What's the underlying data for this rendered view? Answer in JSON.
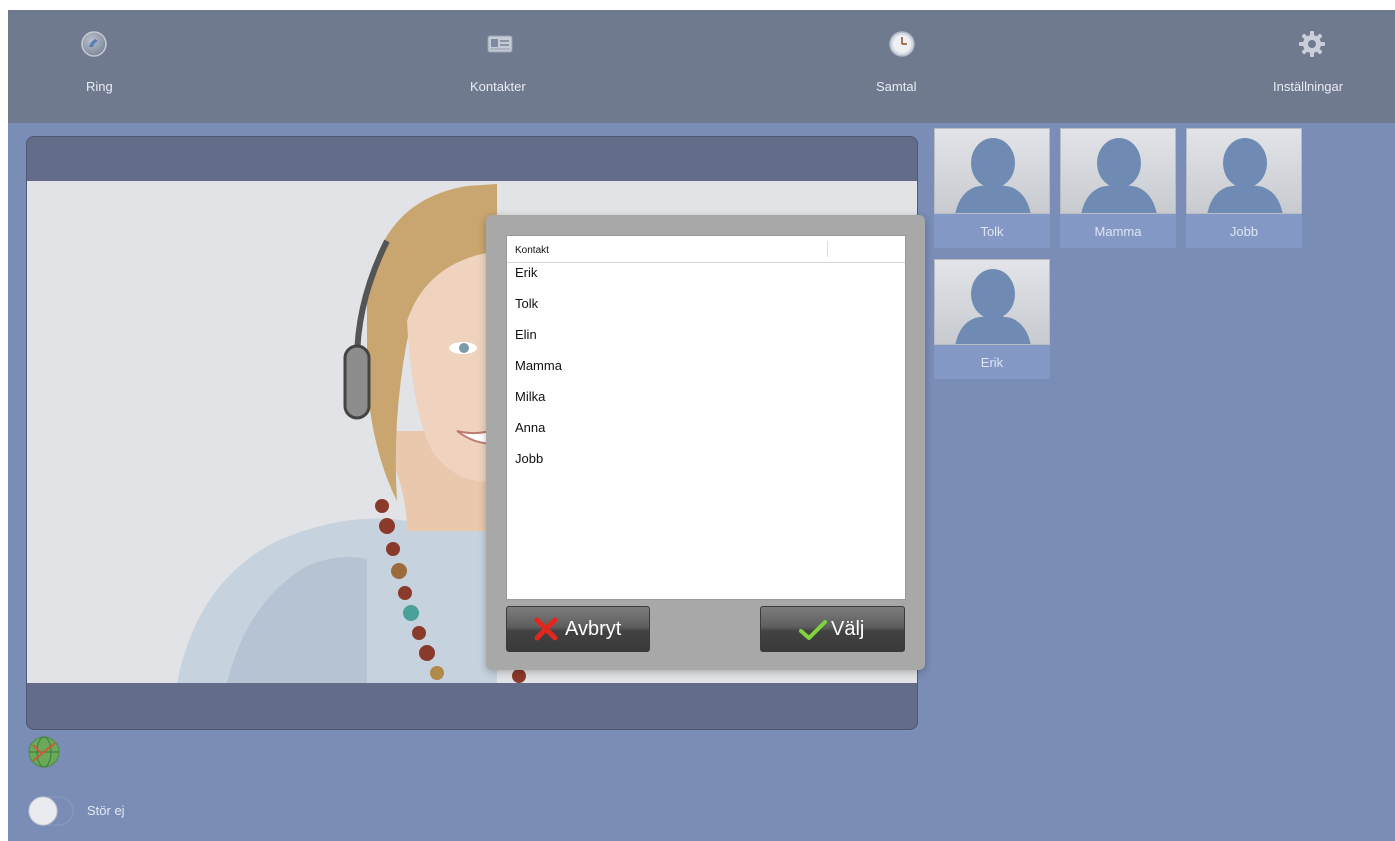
{
  "nav": {
    "items": [
      {
        "label": "Ring",
        "icon": "phone-icon"
      },
      {
        "label": "Kontakter",
        "icon": "contact-card-icon"
      },
      {
        "label": "Samtal",
        "icon": "clock-icon"
      },
      {
        "label": "Inställningar",
        "icon": "gear-icon"
      }
    ]
  },
  "dialog": {
    "column_header": "Kontakt",
    "contacts": [
      "Erik",
      "Tolk",
      "Elin",
      "Mamma",
      "Milka",
      "Anna",
      "Jobb"
    ],
    "cancel_label": "Avbryt",
    "select_label": "Välj"
  },
  "favorites": [
    {
      "name": "Tolk"
    },
    {
      "name": "Mamma"
    },
    {
      "name": "Jobb"
    },
    {
      "name": "Erik"
    }
  ],
  "footer": {
    "dnd_label": "Stör ej",
    "dnd_enabled": false
  },
  "colors": {
    "background": "#7a8db6",
    "nav_bar": "#6f7a8e",
    "video_frame": "#636d8a",
    "modal": "#a8a8a8",
    "cancel_icon": "#d9281f",
    "select_icon": "#7dd23a"
  }
}
